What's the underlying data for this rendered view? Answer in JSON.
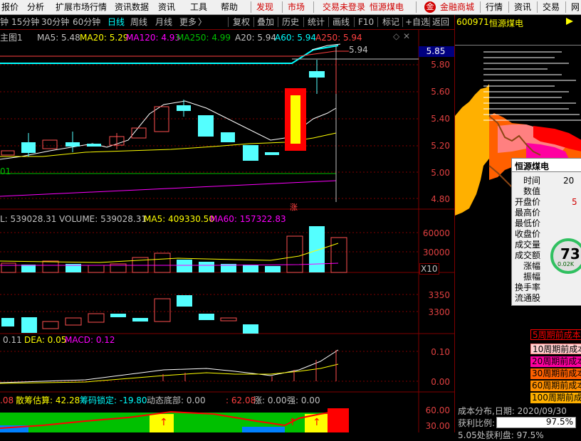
{
  "menu": {
    "items": [
      "报价",
      "分析",
      "扩展市场行情",
      "资讯数据",
      "资讯",
      "工具",
      "帮助"
    ],
    "publish": "发现",
    "market": "市场",
    "trade_status": "交易未登录",
    "stock_name": "恒源煤电",
    "mall": "金融商城",
    "quote": "行情",
    "news": "资讯",
    "trading": "交易",
    "net": "网"
  },
  "toolbar": {
    "periods": [
      "钟",
      "15分钟",
      "30分钟",
      "60分钟",
      "日线",
      "周线",
      "月线",
      "更多"
    ],
    "active_period": "日线",
    "more_arrow": "〉",
    "actions": [
      "复权",
      "叠加",
      "历史",
      "统计",
      "画线",
      "F10",
      "标记",
      "+自选",
      "返回"
    ]
  },
  "stock_header": {
    "code": "600971",
    "name": "恒源煤电"
  },
  "main_chart": {
    "label": "主图1",
    "ma5": "MA5: 5.48",
    "ma20": "MA20: 5.29",
    "ma120": "MA120: 4.93",
    "ma250": "MA250: 4.99",
    "a20": "A20: 5.94",
    "a60": "A60: 5.94",
    "a250": "A250: 5.94",
    "peak_label": "5.94",
    "left_tag": "01",
    "zhang_tag": "涨",
    "y_ticks": [
      "5.85",
      "5.80",
      "5.60",
      "5.40",
      "5.20",
      "5.00",
      "4.80"
    ]
  },
  "volume_chart": {
    "l_label": "L: 539028.31",
    "volume": "VOLUME: 539028.31",
    "ma5": "MA5: 409330.50",
    "ma60": "MA60: 157322.83",
    "y_ticks": [
      "60000",
      "30000"
    ],
    "unit": "X10"
  },
  "third_chart": {
    "y_ticks": [
      "3350",
      "3300"
    ]
  },
  "macd_chart": {
    "dif": "0.11",
    "dea": "DEA: 0.05",
    "macd": "MACD: 0.12",
    "y_ticks": [
      "0.10",
      "0.00"
    ]
  },
  "chip_chart": {
    "v1": ".08",
    "sanchou": "散筹估算: 42.28",
    "suoding": "筹码锁定: -19.80",
    "dongtai": "动态底部: 0.00",
    "v2": ": 62.08",
    "zhang": "涨: 0.00",
    "qiang": "强: 0.00",
    "y_ticks": [
      "60.00",
      "30.00"
    ]
  },
  "infobox": {
    "title": "恒源煤电",
    "rows": [
      {
        "label": "时间",
        "value": "20"
      },
      {
        "label": "数值",
        "value": ""
      },
      {
        "label": "开盘价",
        "value": "5"
      },
      {
        "label": "最高价",
        "value": ""
      },
      {
        "label": "最低价",
        "value": ""
      },
      {
        "label": "收盘价",
        "value": ""
      },
      {
        "label": "成交量",
        "value": ""
      },
      {
        "label": "成交额",
        "value": ""
      },
      {
        "label": "涨幅",
        "value": ""
      },
      {
        "label": "振幅",
        "value": ""
      },
      {
        "label": "换手率",
        "value": ""
      },
      {
        "label": "流通股",
        "value": ""
      }
    ],
    "gauge_value": "73",
    "gauge_sub": "0.02K"
  },
  "cost_legend": [
    {
      "label": "5周期前成本",
      "color": "#ff0000"
    },
    {
      "label": "10周期前成本",
      "color": "#ff8080"
    },
    {
      "label": "20周期前成本",
      "color": "#ff00a0"
    },
    {
      "label": "30周期前成本",
      "color": "#ff6000"
    },
    {
      "label": "60周期前成本",
      "color": "#ff9000"
    },
    {
      "label": "100周期前成本",
      "color": "#ffb000"
    }
  ],
  "cost_footer": {
    "date_line": "成本分布,日期:  2020/09/30",
    "profit_label": "获利比例:",
    "profit_value": "97.5%",
    "bottom_line": "5.05处获利盘:  97.5%"
  }
}
